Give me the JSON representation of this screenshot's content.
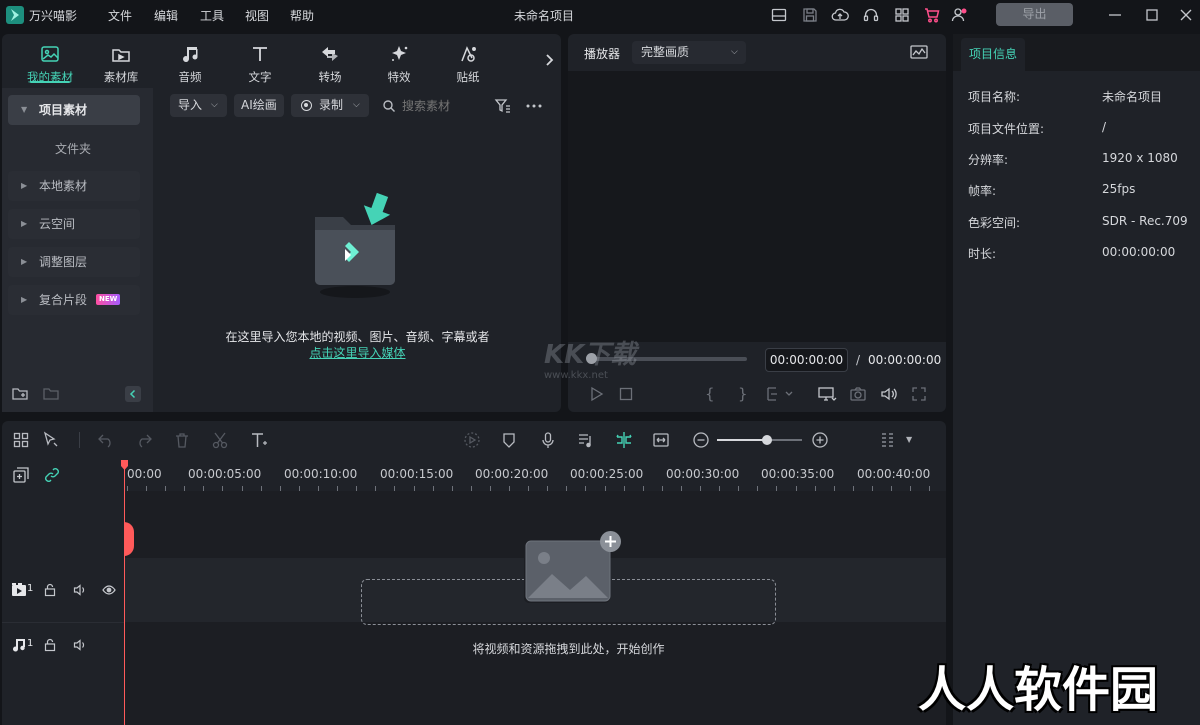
{
  "app": {
    "name": "万兴喵影",
    "project_title": "未命名项目",
    "export_label": "导出"
  },
  "menu": [
    "文件",
    "编辑",
    "工具",
    "视图",
    "帮助"
  ],
  "media_tabs": [
    {
      "label": "我的素材",
      "icon": "folder-image-icon",
      "active": true
    },
    {
      "label": "素材库",
      "icon": "library-icon",
      "active": false
    },
    {
      "label": "音频",
      "icon": "music-note-icon",
      "active": false
    },
    {
      "label": "文字",
      "icon": "text-icon",
      "active": false
    },
    {
      "label": "转场",
      "icon": "transition-icon",
      "active": false
    },
    {
      "label": "特效",
      "icon": "sparkle-icon",
      "active": false
    },
    {
      "label": "贴纸",
      "icon": "sticker-icon",
      "active": false
    }
  ],
  "sidebar": {
    "project_media": "项目素材",
    "folder": "文件夹",
    "items": [
      "本地素材",
      "云空间",
      "调整图层",
      "复合片段"
    ],
    "new_badge": "NEW"
  },
  "media_toolbar": {
    "import": "导入",
    "ai_paint": "AI绘画",
    "record": "录制",
    "search_placeholder": "搜索素材"
  },
  "empty_media": {
    "hint": "在这里导入您本地的视频、图片、音频、字幕或者",
    "link": "点击这里导入媒体"
  },
  "player": {
    "label": "播放器",
    "quality": "完整画质",
    "current_time": "00:00:00:00",
    "separator": "/",
    "total_time": "00:00:00:00",
    "progress": 0
  },
  "project_info": {
    "tab": "项目信息",
    "rows": [
      {
        "label": "项目名称:",
        "value": "未命名项目"
      },
      {
        "label": "项目文件位置:",
        "value": "/"
      },
      {
        "label": "分辨率:",
        "value": "1920 x 1080"
      },
      {
        "label": "帧率:",
        "value": "25fps"
      },
      {
        "label": "色彩空间:",
        "value": "SDR - Rec.709"
      },
      {
        "label": "时长:",
        "value": "00:00:00:00"
      }
    ]
  },
  "timeline": {
    "ruler": [
      "00:00",
      "00:00:05:00",
      "00:00:10:00",
      "00:00:15:00",
      "00:00:20:00",
      "00:00:25:00",
      "00:00:30:00",
      "00:00:35:00",
      "00:00:40:00"
    ],
    "video_track_num": "1",
    "audio_track_num": "1",
    "drop_hint": "将视频和资源拖拽到此处，开始创作"
  },
  "watermark": {
    "text": "人人软件园",
    "logo_text": "KK下载",
    "logo_url_text": "www.kkx.net"
  },
  "colors": {
    "accent": "#45d3b6",
    "playhead": "#ff5a5a",
    "panel": "#1f2228",
    "background": "#131519"
  }
}
